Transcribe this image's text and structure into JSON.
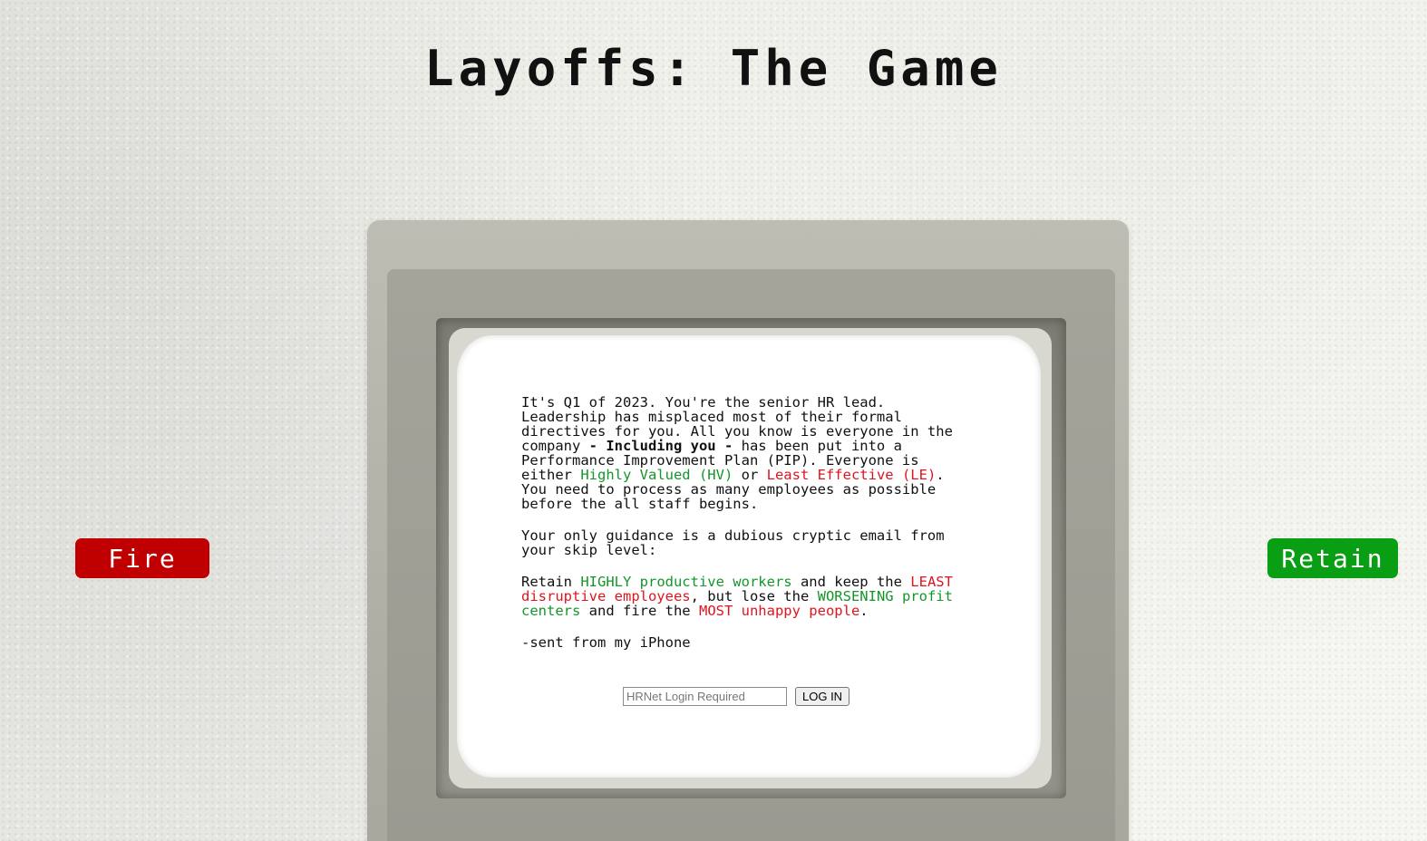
{
  "title": "Layoffs: The Game",
  "buttons": {
    "fire_label": "Fire",
    "retain_label": "Retain"
  },
  "screen": {
    "intro": {
      "part1": "It's Q1 of 2023. You're the senior HR lead. Leadership has misplaced most of their formal directives for you. All you know is everyone in the company ",
      "bold": "- Including you -",
      "part2": " has been put into a Performance Improvement Plan (PIP). Everyone is either ",
      "hv": "Highly Valued (HV)",
      "or": " or ",
      "le": "Least Effective (LE)",
      "part3": ". You need to process as many employees as possible before the all staff begins."
    },
    "guidance": "Your only guidance is a dubious cryptic email from your skip level:",
    "email": {
      "w1": "Retain ",
      "highly": "HIGHLY productive workers",
      "w2": " and keep the ",
      "least": "LEAST disruptive employees",
      "w3": ", but lose the ",
      "worsening": "WORSENING profit centers",
      "w4": " and fire the ",
      "most": "MOST unhappy people",
      "w5": "."
    },
    "signature": "-sent from my iPhone"
  },
  "login": {
    "placeholder": "HRNet Login Required",
    "value": "",
    "button_label": "LOG IN"
  },
  "colors": {
    "fire": "#c00000",
    "retain": "#0a9e14",
    "positive_text": "#14962a",
    "negative_text": "#e0141e"
  }
}
